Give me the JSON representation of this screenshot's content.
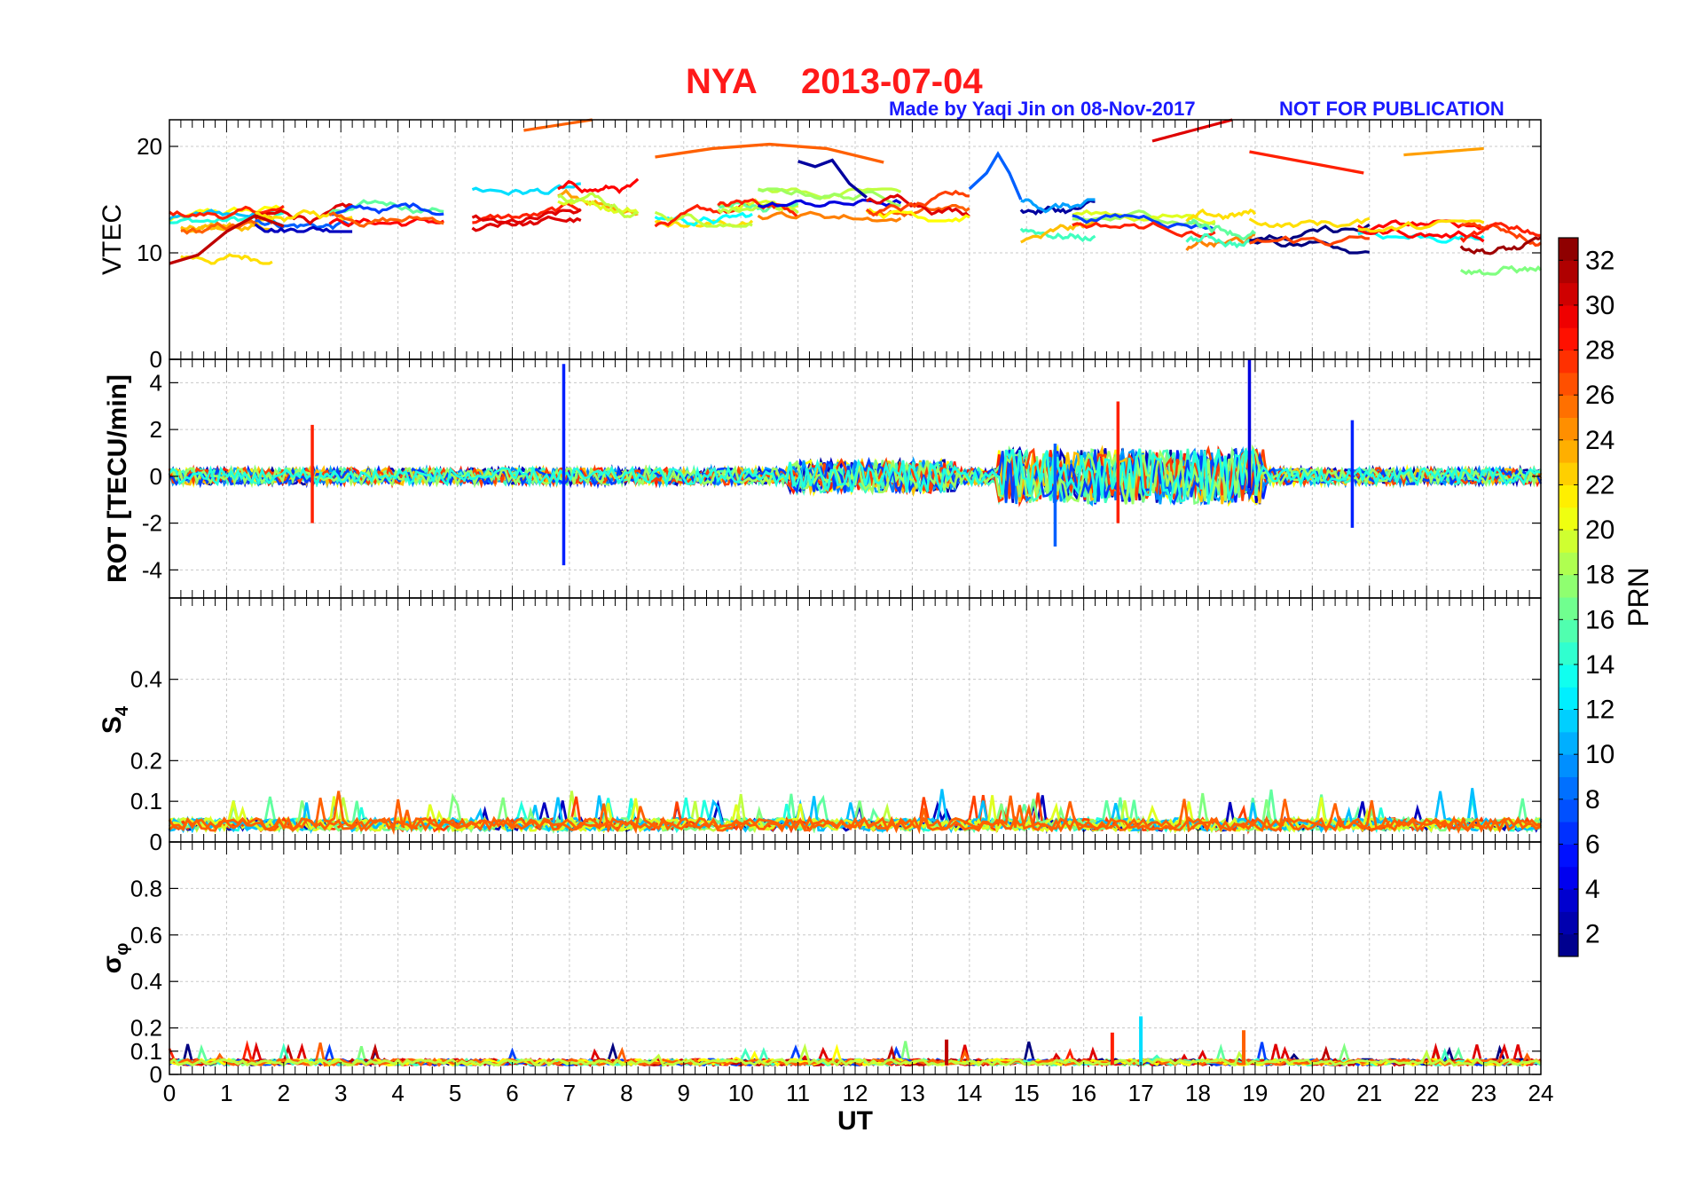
{
  "title_station": "NYA",
  "title_date": "2013-07-04",
  "credit": "Made by Yaqi Jin on 08-Nov-2017",
  "disclaimer": "NOT FOR PUBLICATION",
  "colors": {
    "title": "#ff1a1a",
    "note": "#1a1aff",
    "grid": "#c8c8c8"
  },
  "chart_data": [
    {
      "type": "line",
      "panel": "vtec",
      "ylabel": "VTEC",
      "xlim": [
        0,
        24
      ],
      "ylim": [
        0,
        22.5
      ],
      "yticks": [
        0,
        10,
        20
      ],
      "grid": true,
      "series_summary": "multiple PRN traces, roughly 10-20 TECU with gaps",
      "sample_tracks": [
        {
          "prn": 2,
          "x": [
            11.0,
            11.3,
            11.6,
            11.9,
            12.2
          ],
          "y": [
            18.6,
            18.1,
            18.7,
            16.5,
            15.2
          ]
        },
        {
          "prn": 8,
          "x": [
            14.0,
            14.3,
            14.5,
            14.7,
            14.9
          ],
          "y": [
            16.0,
            17.5,
            19.3,
            17.5,
            15.0
          ]
        },
        {
          "prn": 26,
          "x": [
            8.5,
            9.5,
            10.5,
            11.5,
            12.5
          ],
          "y": [
            19.0,
            19.8,
            20.2,
            19.8,
            18.5
          ]
        },
        {
          "prn": 31,
          "x": [
            0.0,
            0.5,
            1.0,
            1.5,
            2.0
          ],
          "y": [
            9.0,
            9.8,
            12.0,
            13.5,
            12.5
          ]
        },
        {
          "prn": 28,
          "x": [
            18.9,
            19.4,
            19.9,
            20.4,
            20.9
          ],
          "y": [
            19.5,
            19.0,
            18.5,
            18.0,
            17.5
          ]
        }
      ]
    },
    {
      "type": "line",
      "panel": "rot",
      "ylabel": "ROT [TECU/min]",
      "xlim": [
        0,
        24
      ],
      "ylim": [
        -5.2,
        5.0
      ],
      "yticks": [
        -4,
        -2,
        0,
        2,
        4
      ],
      "grid": true,
      "spikes": [
        {
          "x": 2.5,
          "y": [
            -2.0,
            2.2
          ],
          "prn": 28
        },
        {
          "x": 6.9,
          "y": [
            -3.8,
            4.8
          ],
          "prn": 6
        },
        {
          "x": 18.9,
          "y": [
            -0.5,
            5.0
          ],
          "prn": 4
        },
        {
          "x": 20.7,
          "y": [
            -2.2,
            2.4
          ],
          "prn": 6
        },
        {
          "x": 16.6,
          "y": [
            -2.0,
            3.2
          ],
          "prn": 28
        },
        {
          "x": 15.5,
          "y": [
            -3.0,
            1.4
          ],
          "prn": 8
        }
      ]
    },
    {
      "type": "line",
      "panel": "s4",
      "ylabel": "S4",
      "xlim": [
        0,
        24
      ],
      "ylim": [
        0,
        0.6
      ],
      "yticks": [
        0,
        0.1,
        0.2,
        0.4
      ],
      "grid": true,
      "baseline": 0.04
    },
    {
      "type": "line",
      "panel": "sigma_phi",
      "ylabel": "σφ",
      "xlim": [
        0,
        24
      ],
      "ylim": [
        0,
        1.0
      ],
      "yticks": [
        0,
        0.1,
        0.2,
        0.4,
        0.6,
        0.8
      ],
      "grid": true,
      "baseline": 0.05,
      "spikes": [
        {
          "x": 16.5,
          "y": 0.18,
          "prn": 28
        },
        {
          "x": 17.0,
          "y": 0.25,
          "prn": 12
        },
        {
          "x": 18.8,
          "y": 0.19,
          "prn": 26
        },
        {
          "x": 13.6,
          "y": 0.15,
          "prn": 31
        }
      ]
    }
  ],
  "xaxis": {
    "label": "UT",
    "ticks": [
      "0",
      "1",
      "2",
      "3",
      "4",
      "5",
      "6",
      "7",
      "8",
      "9",
      "10",
      "11",
      "12",
      "13",
      "14",
      "15",
      "16",
      "17",
      "18",
      "19",
      "20",
      "21",
      "22",
      "23",
      "24"
    ]
  },
  "colorbar": {
    "label": "PRN",
    "range": [
      1,
      33
    ],
    "ticks": [
      "2",
      "4",
      "6",
      "8",
      "10",
      "12",
      "14",
      "16",
      "18",
      "20",
      "22",
      "24",
      "26",
      "28",
      "30",
      "32"
    ],
    "colormap": "jet"
  }
}
